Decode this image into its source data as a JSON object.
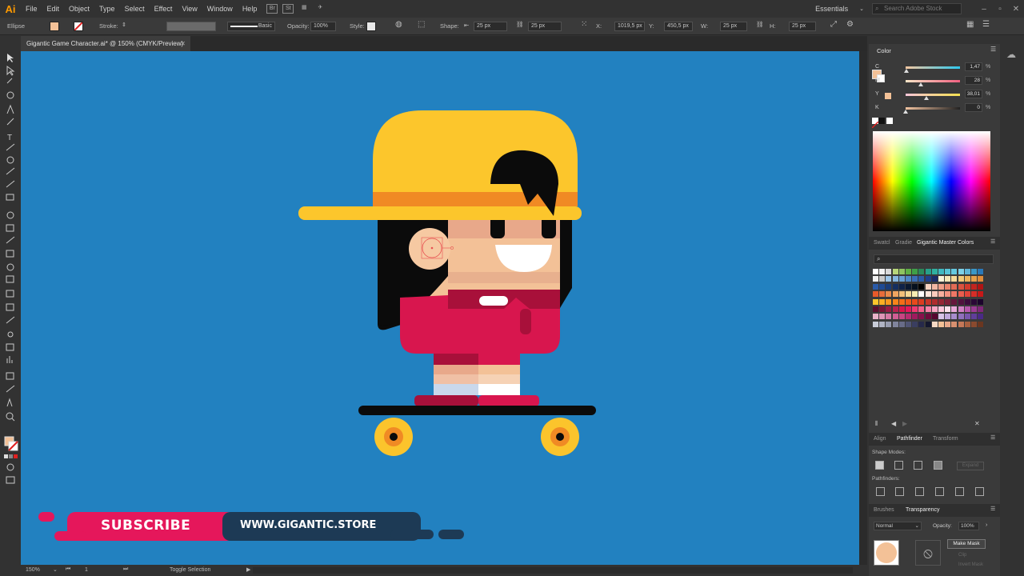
{
  "app": {
    "logo": "Ai",
    "menus": [
      "File",
      "Edit",
      "Object",
      "Type",
      "Select",
      "Effect",
      "View",
      "Window",
      "Help"
    ],
    "bridge_buttons": [
      "Br",
      "St"
    ],
    "workspace": "Essentials",
    "stock_search_placeholder": "Search Adobe Stock"
  },
  "control": {
    "selection_label": "Ellipse",
    "stroke_label": "Stroke:",
    "brush_label": "Basic",
    "opacity_label": "Opacity:",
    "opacity_value": "100%",
    "style_label": "Style:",
    "shape_label": "Shape:",
    "shape_w": "25 px",
    "shape_h": "25 px",
    "x_label": "X:",
    "x_value": "1019,5 px",
    "y_label": "Y:",
    "y_value": "450,5 px",
    "w_label": "W:",
    "w_value": "25 px",
    "h_label": "H:",
    "h_value": "25 px"
  },
  "document": {
    "tab_title": "Gigantic Game Character.ai* @ 150% (CMYK/Preview)"
  },
  "status": {
    "zoom": "150%",
    "artboard": "1",
    "message": "Toggle Selection"
  },
  "color_panel": {
    "title": "Color",
    "channels": [
      {
        "name": "C",
        "value": "1,47",
        "pct": 0.0147,
        "gradient": "linear-gradient(90deg,#f5c7a0,#2ec8ee)"
      },
      {
        "name": "M",
        "value": "28",
        "pct": 0.28,
        "gradient": "linear-gradient(90deg,#fce7c8,#f06080)"
      },
      {
        "name": "Y",
        "value": "38,01",
        "pct": 0.38,
        "gradient": "linear-gradient(90deg,#f8c5d8,#f5e050)"
      },
      {
        "name": "K",
        "value": "0",
        "pct": 0.0,
        "gradient": "linear-gradient(90deg,#f3c3a0,#222222)"
      }
    ],
    "percent_sign": "%",
    "fill_color": "#f3c197"
  },
  "swatch_panel": {
    "tabs": [
      "Swatcl",
      "Gradie",
      "Gigantic Master Colors"
    ]
  },
  "pathfinder_panel": {
    "tabs": [
      "Align",
      "Pathfinder",
      "Transform"
    ],
    "shape_modes_label": "Shape Modes:",
    "pathfinders_label": "Pathfinders:",
    "expand_label": "Expand"
  },
  "transparency_panel": {
    "tabs": [
      "Brushes",
      "Transparency"
    ],
    "blend_mode": "Normal",
    "opacity_label": "Opacity:",
    "opacity_value": "100%",
    "make_mask_label": "Make Mask",
    "clip_label": "Clip",
    "invert_mask_label": "Invert Mask"
  },
  "banner": {
    "subscribe": "SUBSCRIBE",
    "website": "WWW.GIGANTIC.STORE"
  },
  "colors": {
    "canvas": "#2281c0",
    "hat": "#fcc62c",
    "hat_band": "#f08a24",
    "skin": "#f3c197",
    "shirt": "#d8164e",
    "hair": "#0b0b0b",
    "wheel": "#fbc42c",
    "banner_pink": "#e5175b",
    "banner_dark": "#1d3a55"
  }
}
